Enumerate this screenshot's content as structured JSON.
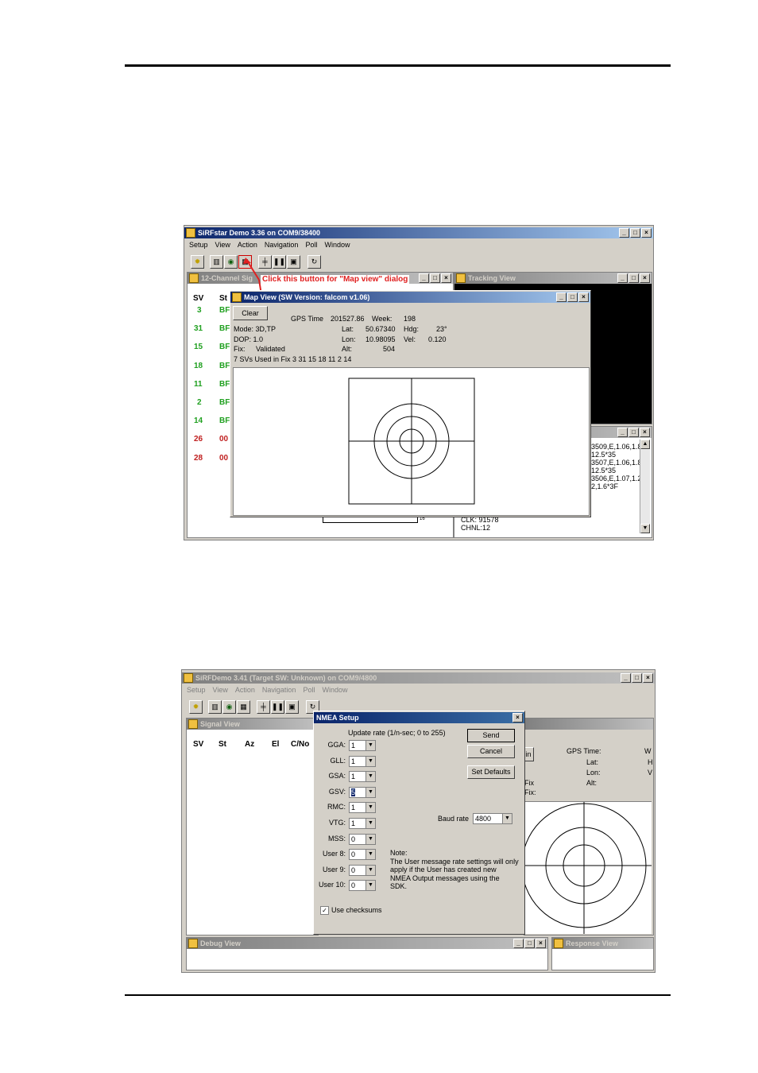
{
  "shot1": {
    "app_title": "SiRFstar Demo 3.36 on COM9/38400",
    "menu": [
      "Setup",
      "View",
      "Action",
      "Navigation",
      "Poll",
      "Window"
    ],
    "signal_title": "12-Channel Sig",
    "tracking_title": "Tracking View",
    "callout": "Click this button for \"Map view\" dialog",
    "sv_header": "SV",
    "st_header": "St",
    "rows": [
      {
        "sv": "3",
        "st": "BF",
        "status": "ok"
      },
      {
        "sv": "31",
        "st": "BF",
        "status": "ok"
      },
      {
        "sv": "15",
        "st": "BF",
        "status": "ok"
      },
      {
        "sv": "18",
        "st": "BF",
        "status": "ok"
      },
      {
        "sv": "11",
        "st": "BF",
        "status": "ok"
      },
      {
        "sv": "2",
        "st": "BF",
        "status": "ok"
      },
      {
        "sv": "14",
        "st": "BF",
        "status": "ok"
      },
      {
        "sv": "26",
        "st": "00",
        "status": "bad"
      },
      {
        "sv": "28",
        "st": "00",
        "status": "bad"
      }
    ],
    "map": {
      "title": "Map View (SW Version: falcom v1.06)",
      "clear": "Clear",
      "gps_time_label": "GPS Time",
      "gps_time": "201527.86",
      "week_label": "Week:",
      "week": "198",
      "mode": "Mode: 3D,TP",
      "lat_label": "Lat:",
      "lat": "50.67340",
      "hdg_label": "Hdg:",
      "hdg": "23°",
      "dop": "DOP:  1.0",
      "lon_label": "Lon:",
      "lon": "10.98095",
      "vel_label": "Vel:",
      "vel": "0.120",
      "fix_label": "Fix:",
      "fix": "Validated",
      "alt_label": "Alt:",
      "alt": "504",
      "svs_used": "7  SVs Used in Fix  3 31 15 18 11 2 14"
    },
    "response_lines": [
      "3509,E,1.06,1.8",
      "12.5*35",
      "3507,E,1.06,1.8",
      "12.5*35",
      "3506,E,1.07,1.2",
      "2,1.6*3F"
    ],
    "clk": "CLK: 91578",
    "chnl": "CHNL:12",
    "scale_label": "16"
  },
  "shot2": {
    "app_title": "SiRFDemo 3.41 (Target SW: Unknown) on COM9/4800",
    "menu": [
      "Setup",
      "View",
      "Action",
      "Navigation",
      "Poll",
      "Window"
    ],
    "signal_title": "Signal View",
    "sig_headers": [
      "SV",
      "St",
      "Az",
      "El",
      "C/No"
    ],
    "debug_title": "Debug View",
    "response_title": "Response View",
    "gps_time_label": "GPS Time:",
    "lat_label": "Lat:",
    "lon_label": "Lon:",
    "alt_label": "Alt:",
    "fix1": "Fix",
    "fix2": "Fix:",
    "right_w": "W",
    "right_h": "H",
    "right_v": "V",
    "in_btn": "in",
    "nmea": {
      "title": "NMEA Setup",
      "update_rate": "Update rate (1/n-sec; 0 to 255)",
      "send": "Send",
      "cancel": "Cancel",
      "set_defaults": "Set Defaults",
      "baud_label": "Baud rate",
      "baud_value": "4800",
      "fields": [
        {
          "label": "GGA:",
          "value": "1"
        },
        {
          "label": "GLL:",
          "value": "1"
        },
        {
          "label": "GSA:",
          "value": "1"
        },
        {
          "label": "GSV:",
          "value": "5"
        },
        {
          "label": "RMC:",
          "value": "1"
        },
        {
          "label": "VTG:",
          "value": "1"
        },
        {
          "label": "MSS:",
          "value": "0"
        },
        {
          "label": "User 8:",
          "value": "0"
        },
        {
          "label": "User 9:",
          "value": "0"
        },
        {
          "label": "User 10:",
          "value": "0"
        }
      ],
      "note": "Note:\nThe User message rate settings will only\napply if the User has created new\nNMEA Output messages using the\nSDK.",
      "checksums": "Use checksums"
    }
  }
}
